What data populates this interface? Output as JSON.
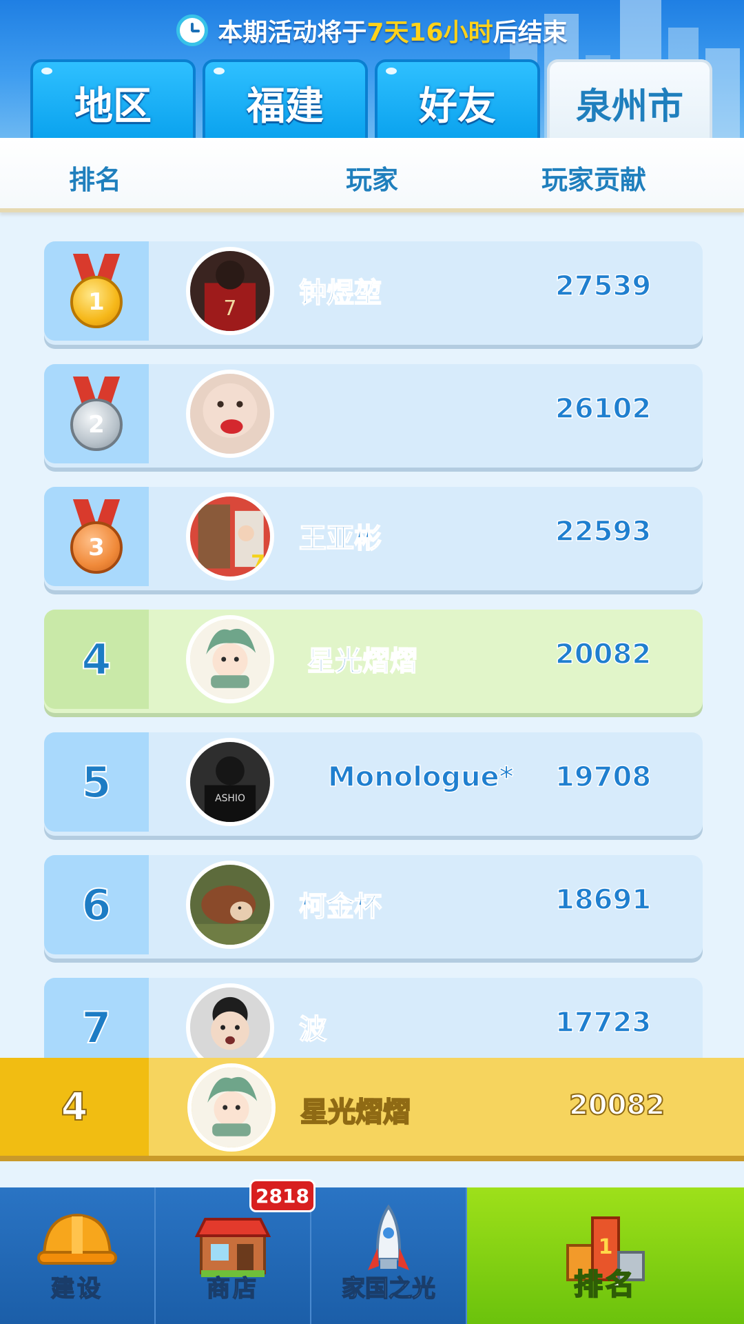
{
  "event_timer": {
    "prefix": "本期活动将于",
    "remaining": "7天16小时",
    "suffix": "后结束"
  },
  "tabs": [
    {
      "label": "地区",
      "active": false
    },
    {
      "label": "福建",
      "active": false
    },
    {
      "label": "好友",
      "active": false
    },
    {
      "label": "泉州市",
      "active": true
    }
  ],
  "columns": {
    "rank": "排名",
    "player": "玩家",
    "contribution": "玩家贡献"
  },
  "ranking": [
    {
      "rank": 1,
      "medal": "gold-medal",
      "name": "钟煜堃",
      "score": "27539"
    },
    {
      "rank": 2,
      "medal": "silver-medal",
      "name": "",
      "score": "26102"
    },
    {
      "rank": 3,
      "medal": "bronze-medal",
      "name": "王亚彬",
      "score": "22593"
    },
    {
      "rank": "4",
      "name": "星光熠熠",
      "score": "20082",
      "is_me": true
    },
    {
      "rank": "5",
      "name": "Monologue*",
      "score": "19708"
    },
    {
      "rank": "6",
      "name": "柯金杯",
      "score": "18691"
    },
    {
      "rank": "7",
      "name": "波",
      "score": "17723"
    }
  ],
  "medal_numbers": [
    "1",
    "2",
    "3"
  ],
  "my_rank": {
    "rank": "4",
    "name": "星光熠熠",
    "score": "20082"
  },
  "nav": {
    "build": "建设",
    "shop": "商店",
    "shop_badge": "2818",
    "homeland": "家国之光",
    "ranking": "排名"
  },
  "colors": {
    "accent_blue": "#1f7fcf",
    "tab_blue": "#0aa2ee",
    "highlight_green": "#e1f5c9",
    "my_bar_yellow": "#f6d45e",
    "nav_active_green": "#6bc20c",
    "timer_highlight": "#ffd21a"
  }
}
